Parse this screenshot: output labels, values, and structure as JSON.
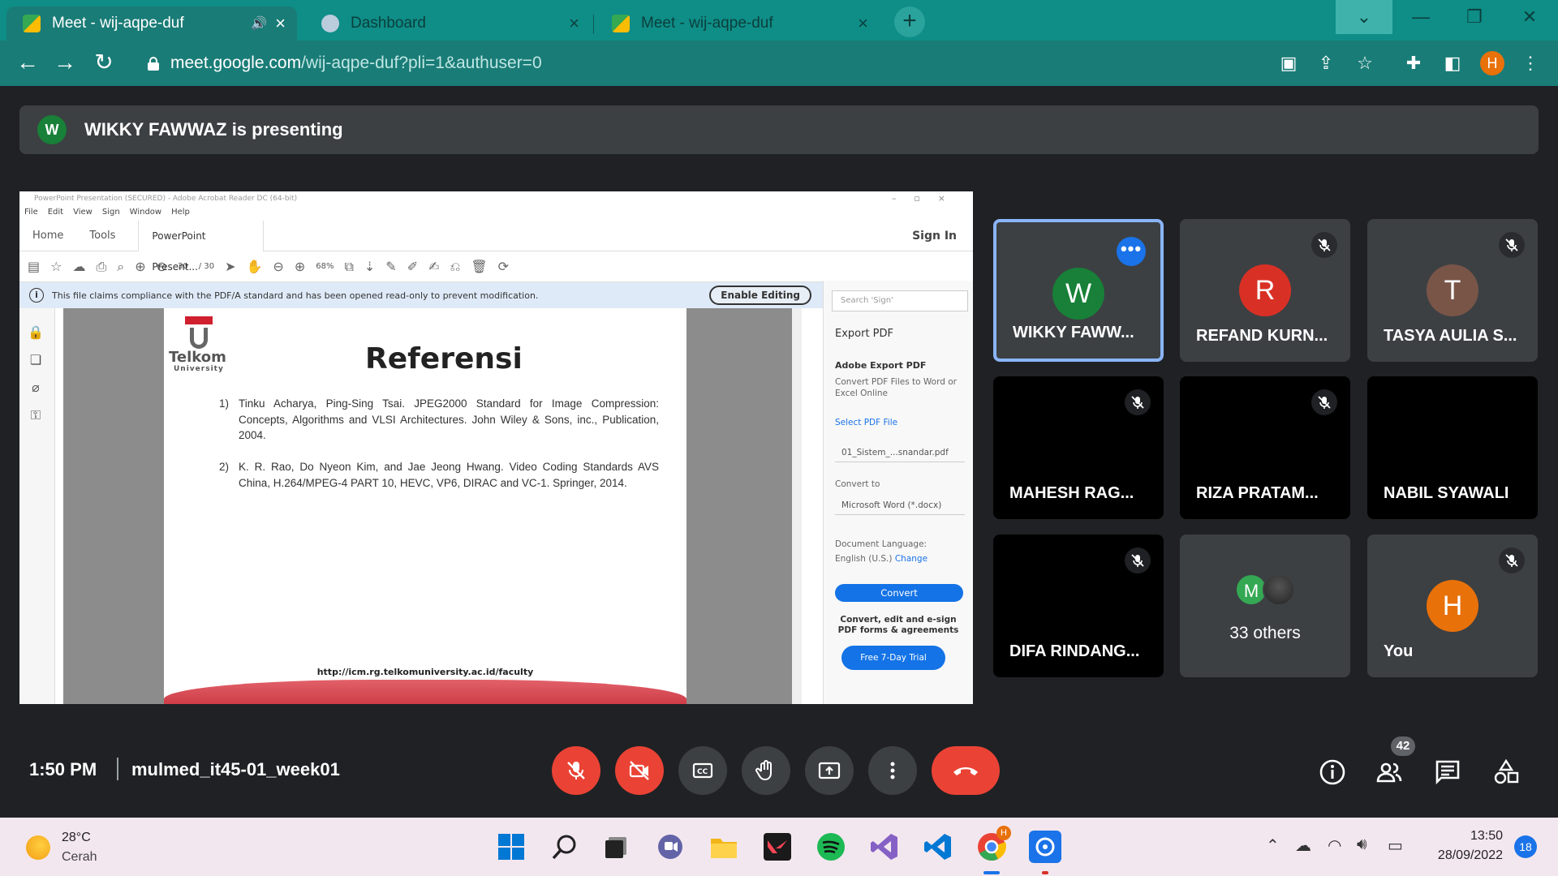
{
  "browser": {
    "tabs": [
      {
        "title": "Meet - wij-aqpe-duf",
        "active": true,
        "audio": true
      },
      {
        "title": "Dashboard",
        "active": false
      },
      {
        "title": "Meet - wij-aqpe-duf",
        "active": false
      }
    ],
    "new_tab_label": "+",
    "url_host": "meet.google.com",
    "url_path": "/wij-aqpe-duf?pli=1&authuser=0",
    "profile_initial": "H",
    "theme_color": "#1a7c77"
  },
  "meet": {
    "banner": {
      "avatar_initial": "W",
      "text": "WIKKY FAWWAZ is presenting"
    },
    "participants": [
      {
        "name": "WIKKY FAWW...",
        "initial": "W",
        "color": "#188038"
      },
      {
        "name": "REFAND KURN...",
        "initial": "R",
        "color": "#d93025"
      },
      {
        "name": "TASYA AULIA S...",
        "initial": "T",
        "color": "#795548"
      },
      {
        "name": "MAHESH RAG..."
      },
      {
        "name": "RIZA PRATAM..."
      },
      {
        "name": "NABIL SYAWALI"
      },
      {
        "name": "DIFA RINDANG..."
      },
      {
        "name": "You",
        "initial": "H",
        "color": "#e8710a"
      }
    ],
    "others": {
      "initial": "M",
      "label": "33 others"
    },
    "clock": "1:50 PM",
    "meeting_code": "mulmed_it45-01_week01",
    "people_count": "42"
  },
  "acrobat": {
    "window_title": "PowerPoint Presentation (SECURED) - Adobe Acrobat Reader DC (64-bit)",
    "menu": [
      "File",
      "Edit",
      "View",
      "Sign",
      "Window",
      "Help"
    ],
    "tabs": {
      "home": "Home",
      "tools": "Tools",
      "document": "PowerPoint Present..."
    },
    "sign_in": "Sign In",
    "page_current": "30",
    "page_total": "/ 30",
    "zoom": "68%",
    "info_message": "This file claims compliance with the PDF/A standard and has been opened read-only to prevent modification.",
    "enable_editing": "Enable Editing",
    "right_panel": {
      "search_placeholder": "Search 'Sign'",
      "export_pdf": "Export PDF",
      "heading": "Adobe Export PDF",
      "description": "Convert PDF Files to Word or Excel Online",
      "select_file_label": "Select PDF File",
      "file_name": "01_Sistem_...snandar.pdf",
      "convert_to_label": "Convert to",
      "format": "Microsoft Word (*.docx)",
      "language_label": "Document Language:",
      "language_value": "English (U.S.)",
      "change_link": "Change",
      "convert_button": "Convert",
      "promo": "Convert, edit and e-sign PDF forms & agreements",
      "trial_button": "Free 7-Day Trial"
    }
  },
  "slide": {
    "logo_name": "Telkom",
    "logo_sub": "University",
    "title": "Referensi",
    "references": [
      {
        "num": "1)",
        "text": "Tinku Acharya, Ping-Sing Tsai. JPEG2000 Standard for Image Compression: Concepts, Algorithms and VLSI Architectures. John Wiley & Sons, inc., Publication, 2004."
      },
      {
        "num": "2)",
        "text": "K. R. Rao, Do Nyeon Kim, and Jae Jeong Hwang. Video Coding Standards AVS China, H.264/MPEG-4 PART 10, HEVC, VP6, DIRAC and VC-1. Springer, 2014."
      }
    ],
    "footer_url": "http://icm.rg.telkomuniversity.ac.id/faculty"
  },
  "taskbar": {
    "temperature": "28°C",
    "weather": "Cerah",
    "time": "13:50",
    "date": "28/09/2022",
    "notifications": "18",
    "chrome_badge": "H"
  }
}
